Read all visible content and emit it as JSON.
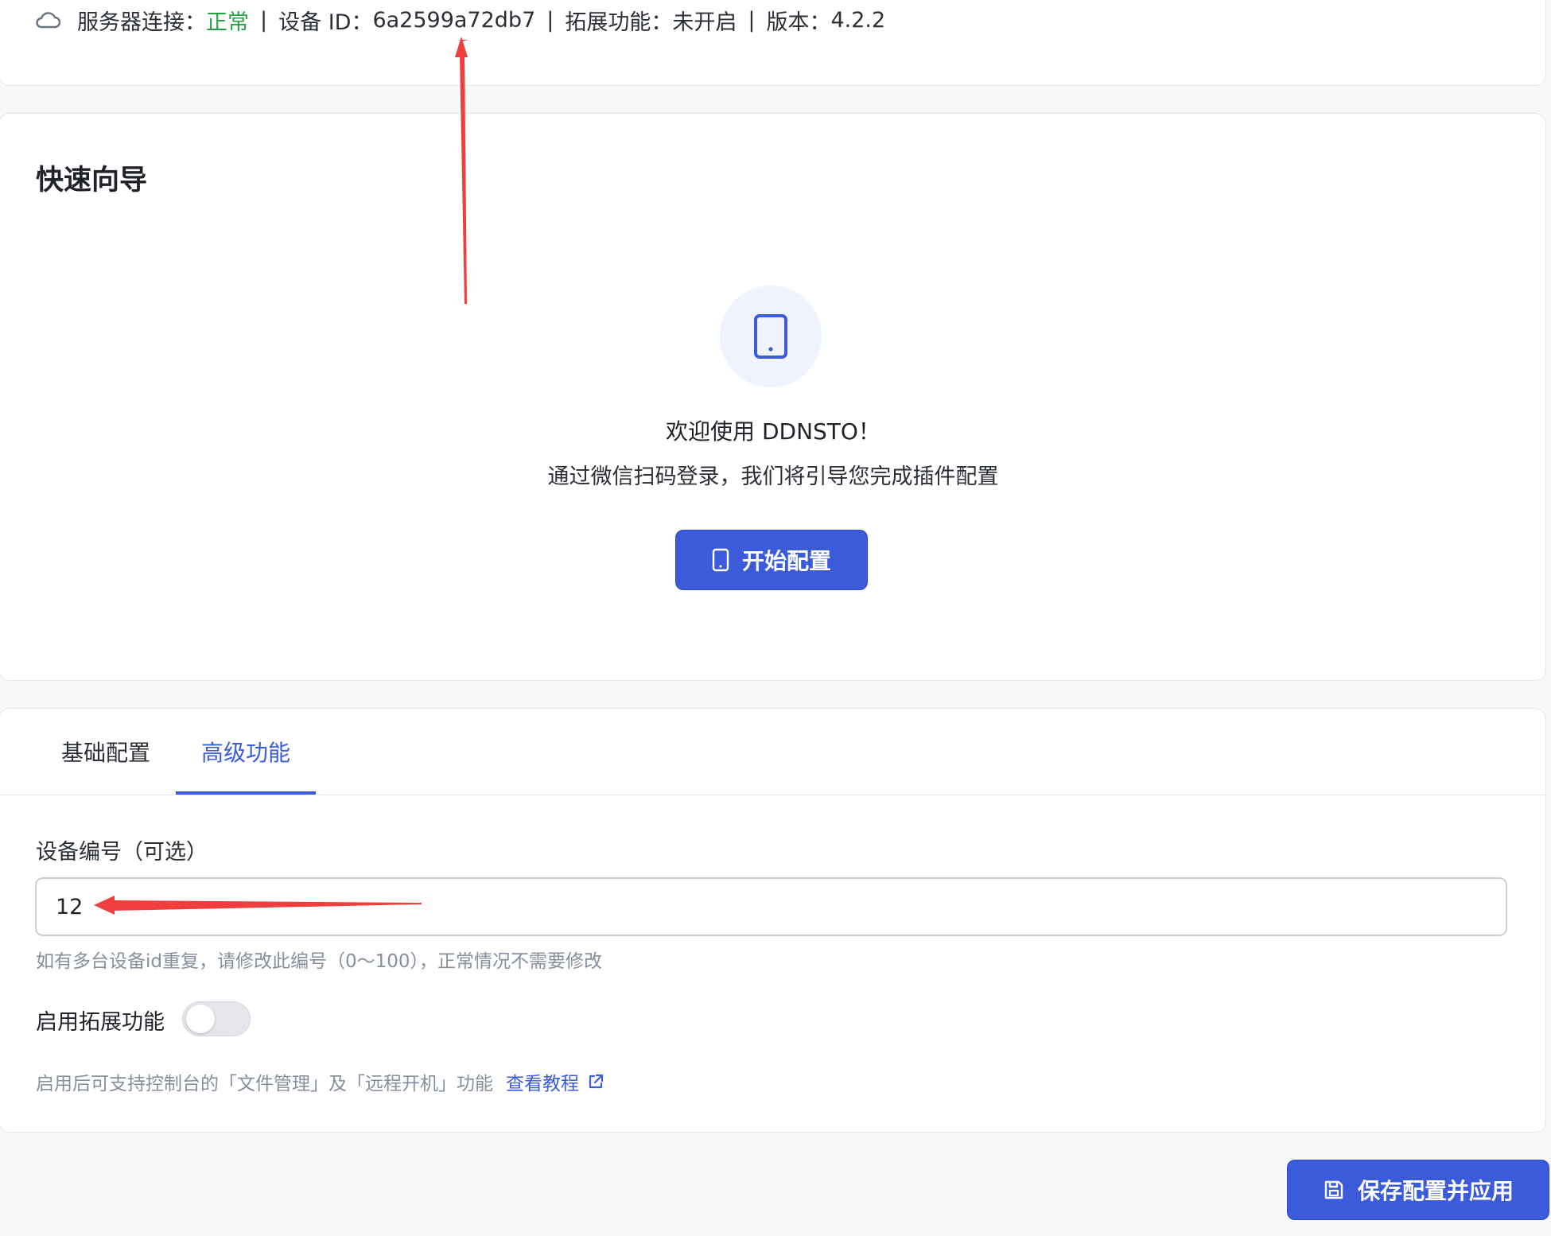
{
  "status": {
    "server_label": "服务器连接：",
    "server_value": "正常",
    "separator": "|",
    "device_id_label": "设备 ID：",
    "device_id_value": "6a2599a72db7",
    "extension_label": "拓展功能：",
    "extension_value": "未开启",
    "version_label": "版本：",
    "version_value": "4.2.2",
    "icon": "cloud-icon",
    "ok_color": "#25a244"
  },
  "guide": {
    "title": "快速向导",
    "welcome": "欢迎使用 DDNSTO！",
    "subtext": "通过微信扫码登录，我们将引导您完成插件配置",
    "start_button": "开始配置",
    "icon": "tablet-icon"
  },
  "settings": {
    "tabs": [
      {
        "label": "基础配置",
        "active": false
      },
      {
        "label": "高级功能",
        "active": true
      }
    ],
    "device_number": {
      "label": "设备编号（可选）",
      "value": "12",
      "help": "如有多台设备id重复，请修改此编号（0～100），正常情况不需要修改"
    },
    "extension_toggle": {
      "label": "启用拓展功能",
      "enabled": false
    },
    "info": {
      "text": "启用后可支持控制台的「文件管理」及「远程开机」功能",
      "link": "查看教程"
    }
  },
  "save_button": "保存配置并应用",
  "colors": {
    "accent": "#3b5bdb",
    "annotation": "#f03e3e"
  }
}
